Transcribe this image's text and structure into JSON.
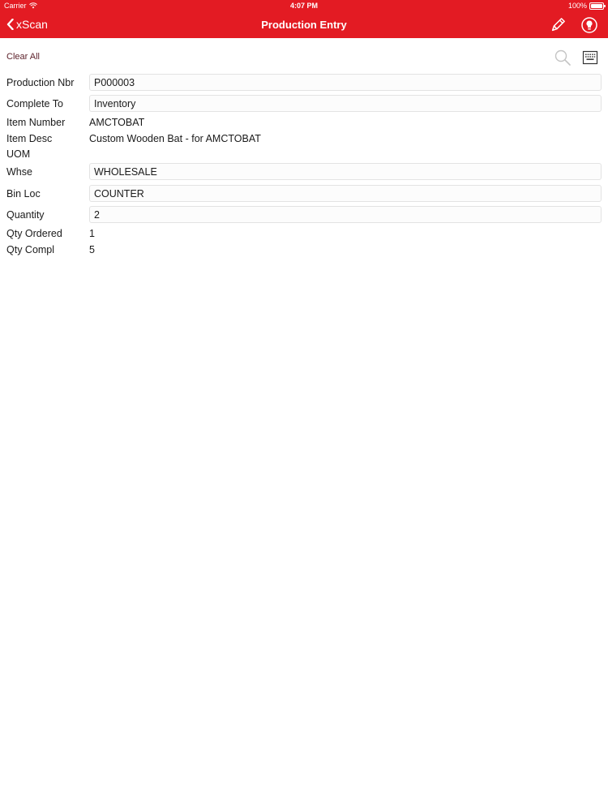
{
  "status_bar": {
    "carrier": "Carrier",
    "time": "4:07 PM",
    "battery": "100%"
  },
  "nav": {
    "back_label": "xScan",
    "title": "Production Entry"
  },
  "toolbar": {
    "clear_all": "Clear All"
  },
  "form": {
    "production_nbr": {
      "label": "Production Nbr",
      "value": "P000003"
    },
    "complete_to": {
      "label": "Complete To",
      "value": "Inventory"
    },
    "item_number": {
      "label": "Item Number",
      "value": "AMCTOBAT"
    },
    "item_desc": {
      "label": "Item Desc",
      "value": "Custom Wooden Bat - for AMCTOBAT"
    },
    "uom": {
      "label": "UOM",
      "value": ""
    },
    "whse": {
      "label": "Whse",
      "value": "WHOLESALE"
    },
    "bin_loc": {
      "label": "Bin Loc",
      "value": "COUNTER"
    },
    "quantity": {
      "label": "Quantity",
      "value": "2"
    },
    "qty_ordered": {
      "label": "Qty Ordered",
      "value": "1"
    },
    "qty_compl": {
      "label": "Qty Compl",
      "value": "5"
    }
  },
  "icons": {
    "back": "chevron-left-icon",
    "edit": "pencil-icon",
    "tip": "lightbulb-icon",
    "search": "search-icon",
    "keyboard": "keyboard-icon"
  },
  "colors": {
    "accent": "#e31b23",
    "link": "#5b1f28"
  }
}
